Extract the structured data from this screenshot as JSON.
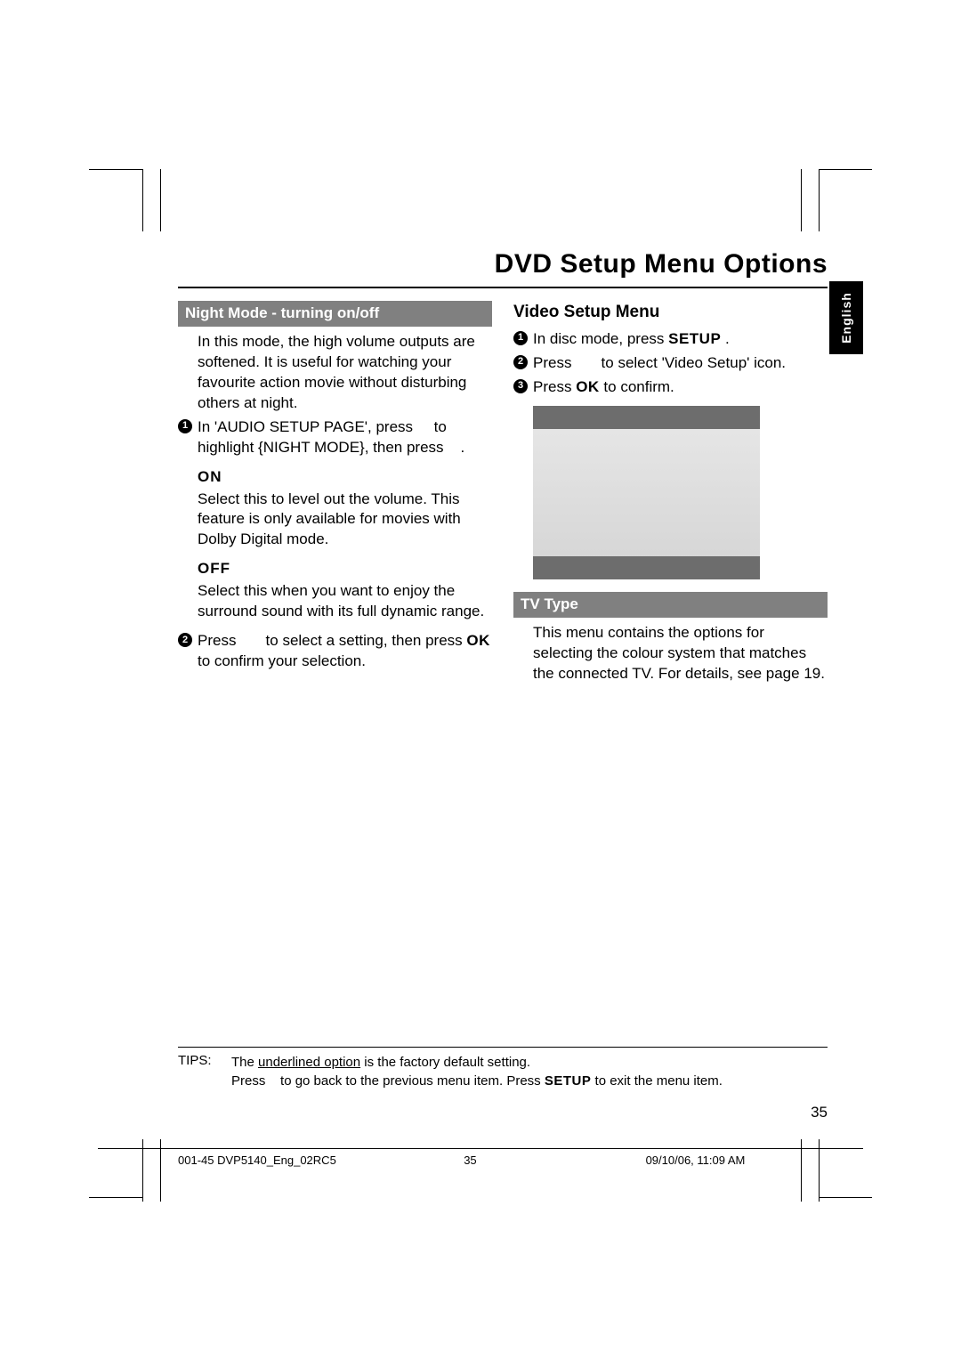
{
  "title": "DVD Setup Menu Options",
  "languageTab": "English",
  "left": {
    "sectionBar": "Night Mode - turning on/off",
    "intro": "In this mode, the high volume outputs are softened.  It is useful for watching your favourite action movie without disturbing others at night.",
    "step1_a": "In 'AUDIO SETUP PAGE', press ",
    "step1_b": " to highlight {NIGHT MODE}, then press ",
    "step1_c": ".",
    "onHead": "ON",
    "onBody": "Select this to level out the volume.  This feature is only available for movies with Dolby Digital mode.",
    "offHead": "OFF",
    "offBody": "Select this when you want to enjoy the surround sound with its full dynamic range.",
    "step2_a": "Press ",
    "step2_b": " to select a setting, then press ",
    "step2_ok": "OK",
    "step2_c": " to confirm your selection."
  },
  "right": {
    "heading": "Video Setup Menu",
    "step1_a": "In disc mode, press ",
    "step1_setup": "SETUP",
    "step1_b": ".",
    "step2_a": "Press ",
    "step2_b": " to select 'Video Setup' icon.",
    "step3_a": "Press ",
    "step3_ok": "OK",
    "step3_b": " to confirm.",
    "tvTypeBar": "TV Type",
    "tvTypeBody": "This menu contains the options for selecting the colour system that matches the connected TV.  For details, see page 19."
  },
  "tips": {
    "label": "TIPS:",
    "line1_a": "The ",
    "line1_underlined": "underlined option",
    "line1_b": " is the factory default setting.",
    "line2_a": "Press ",
    "line2_b": " to go back to the previous menu item. Press ",
    "line2_setup": "SETUP",
    "line2_c": " to exit the menu item."
  },
  "pageNumber": "35",
  "footer": {
    "docId": "001-45 DVP5140_Eng_02RC5",
    "pg": "35",
    "timestamp": "09/10/06, 11:09 AM"
  }
}
